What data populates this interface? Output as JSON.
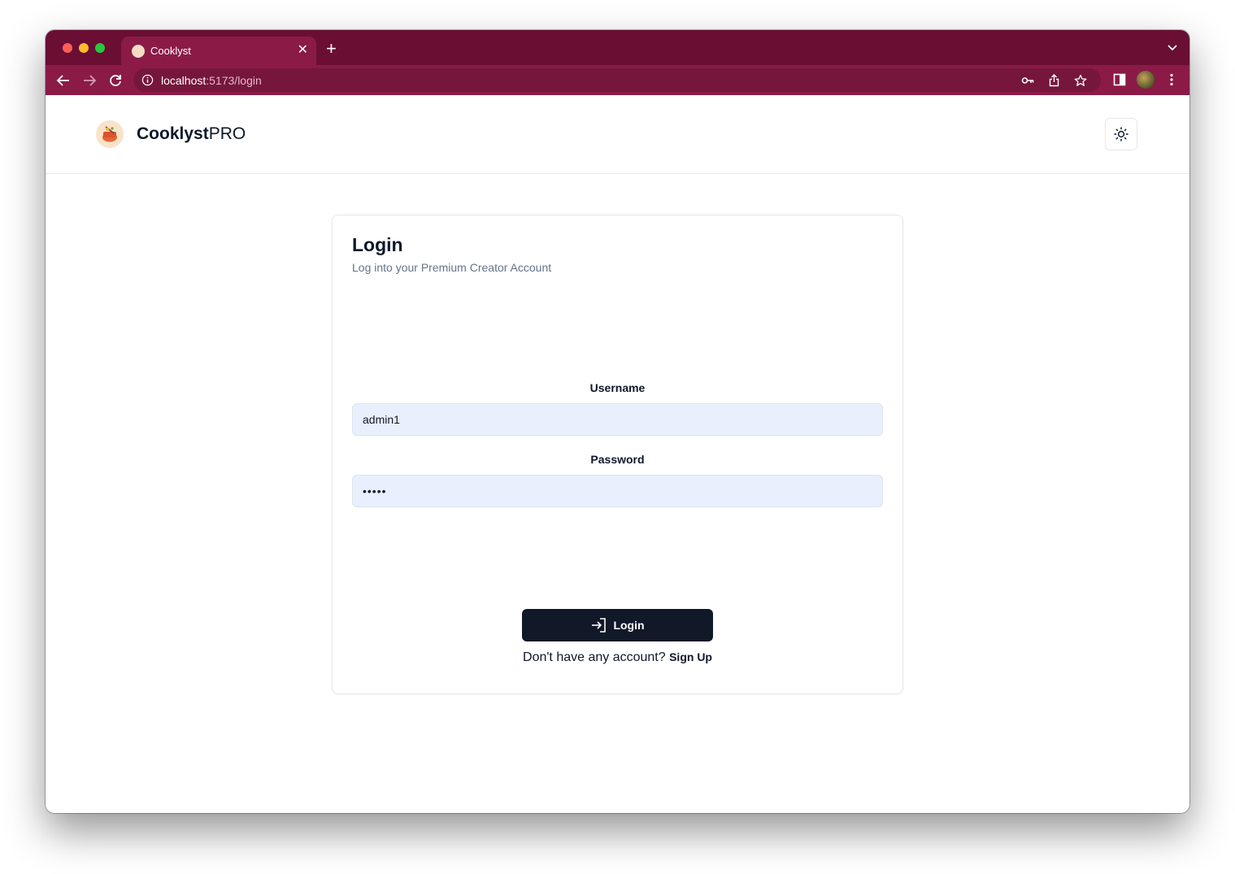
{
  "browser": {
    "tab": {
      "title": "Cooklyst",
      "close_glyph": "✕",
      "favicon": "cooklyst-favicon"
    },
    "new_tab_glyph": "+",
    "url": {
      "host": "localhost",
      "path": ":5173/login"
    },
    "colors": {
      "tab_strip": "#6a0e34",
      "toolbar": "#8b1a47"
    }
  },
  "header": {
    "brand_bold": "Cooklyst",
    "brand_light": "PRO",
    "theme_toggle_icon": "sun-icon"
  },
  "login": {
    "title": "Login",
    "description": "Log into your Premium Creator Account",
    "username_label": "Username",
    "username_value": "admin1",
    "password_label": "Password",
    "password_value": "•••••",
    "button_label": "Login",
    "signup_prompt": "Don't have any account?",
    "signup_link": "Sign Up"
  },
  "colors": {
    "primary_button": "#111827",
    "input_autofill": "#e8f0fe"
  }
}
